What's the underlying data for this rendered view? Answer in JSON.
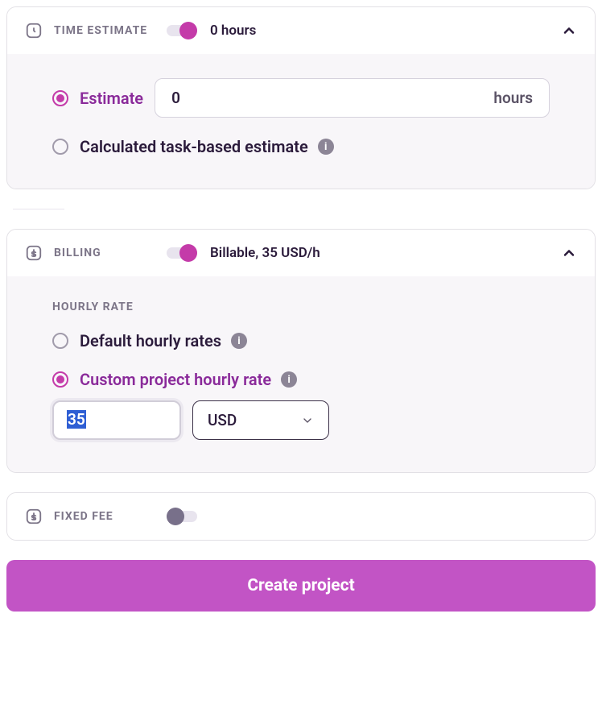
{
  "time_estimate": {
    "title": "TIME ESTIMATE",
    "summary": "0 hours",
    "estimate_label": "Estimate",
    "estimate_value": "0",
    "estimate_suffix": "hours",
    "calculated_label": "Calculated task-based estimate"
  },
  "billing": {
    "title": "BILLING",
    "summary": "Billable, 35 USD/h",
    "hourly_rate_title": "HOURLY RATE",
    "default_label": "Default hourly rates",
    "custom_label": "Custom project hourly rate",
    "rate_value": "35",
    "currency": "USD"
  },
  "fixed_fee": {
    "title": "FIXED FEE"
  },
  "create_button": "Create project"
}
